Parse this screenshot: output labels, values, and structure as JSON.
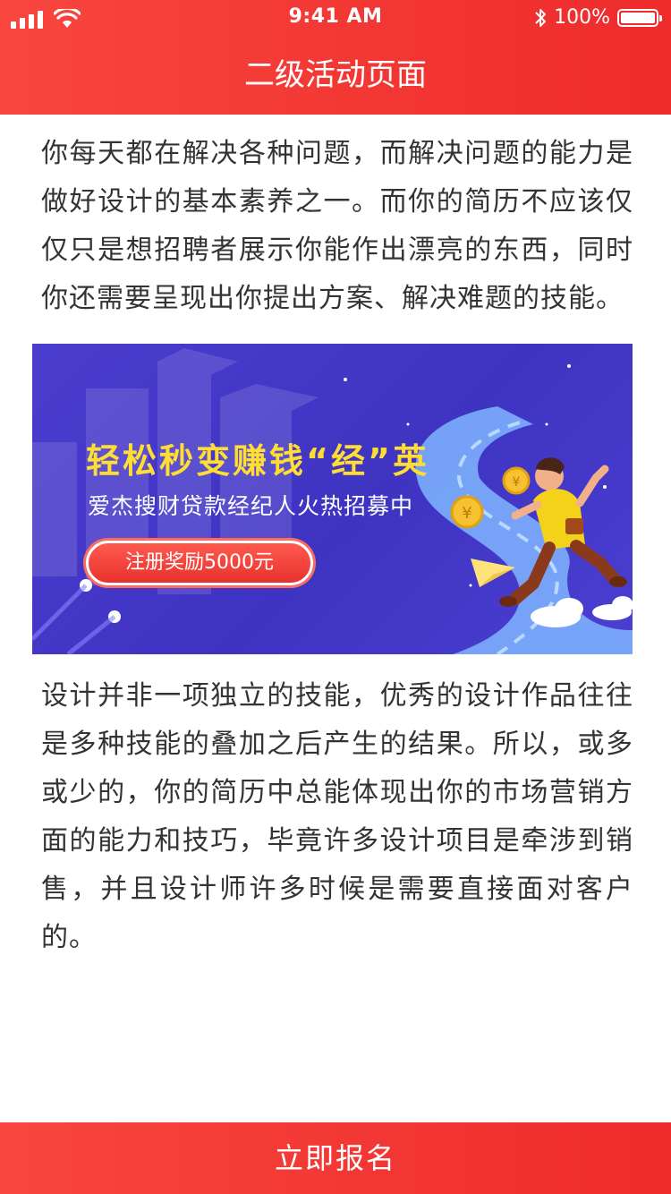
{
  "status_bar": {
    "time": "9:41 AM",
    "battery": "100%"
  },
  "nav": {
    "title": "二级活动页面"
  },
  "content": {
    "paragraph_1": "你每天都在解决各种问题，而解决问题的能力是做好设计的基本素养之一。而你的简历不应该仅仅只是想招聘者展示你能作出漂亮的东西，同时你还需要呈现出你提出方案、解决难题的技能。",
    "paragraph_2": "设计并非一项独立的技能，优秀的设计作品往往是多种技能的叠加之后产生的结果。所以，或多或少的，你的简历中总能体现出你的市场营销方面的能力和技巧，毕竟许多设计项目是牵涉到销售，并且设计师许多时候是需要直接面对客户的。"
  },
  "banner": {
    "title": "轻松秒变赚钱“经”英",
    "subtitle": "爱杰搜财贷款经纪人火热招募中",
    "button": "注册奖励5000元",
    "coin_symbol": "¥"
  },
  "footer": {
    "button": "立即报名"
  },
  "colors": {
    "brand_red": "#ee2b2b",
    "banner_bg": "#4b3cce",
    "banner_title": "#ffdd33"
  }
}
